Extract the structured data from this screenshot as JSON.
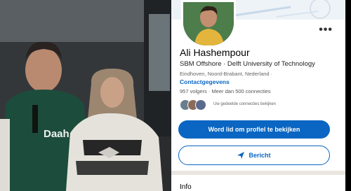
{
  "profile": {
    "name": "Ali Hashempour",
    "headline": "SBM Offshore · Delft University of Technology",
    "location": "Eindhoven, Noord-Brabant, Nederland ·",
    "contact_link": "Contactgegevens",
    "stats": "957 volgers · Meer dan 500 connecties",
    "mutual_connections": "Uw gedeelde connecties bekijken"
  },
  "actions": {
    "join_label": "Word lid om profiel te bekijken",
    "message_label": "Bericht"
  },
  "sections": {
    "info_title": "Info"
  },
  "photo": {
    "shirt_text": "Daah"
  },
  "colors": {
    "accent": "#0a66c2"
  }
}
